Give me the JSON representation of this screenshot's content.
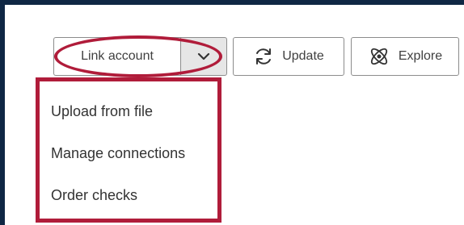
{
  "toolbar": {
    "link_account_label": "Link account",
    "update_label": "Update",
    "explore_label": "Explore"
  },
  "dropdown": {
    "items": [
      {
        "label": "Upload from file"
      },
      {
        "label": "Manage connections"
      },
      {
        "label": "Order checks"
      }
    ]
  },
  "colors": {
    "annotation": "#b01c3a",
    "frame": "#0f2744",
    "caret_bg": "#e6e6e6"
  },
  "icons": {
    "update": "refresh-icon",
    "explore": "atom-icon",
    "caret": "chevron-down-icon"
  }
}
